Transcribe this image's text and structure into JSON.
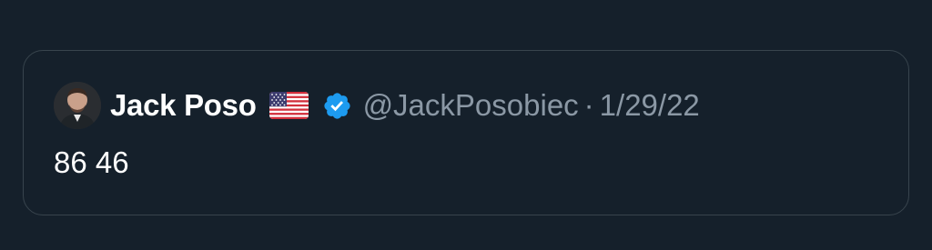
{
  "tweet": {
    "display_name": "Jack Poso",
    "flag_icon": "us-flag-icon",
    "verified_icon": "verified-badge-icon",
    "verified_color": "#1d9bf0",
    "handle": "@JackPosobiec",
    "separator": "·",
    "date": "1/29/22",
    "text": "86 46"
  },
  "colors": {
    "background": "#15202b",
    "border": "#38444d",
    "primary_text": "#ffffff",
    "secondary_text": "#8b98a5"
  }
}
